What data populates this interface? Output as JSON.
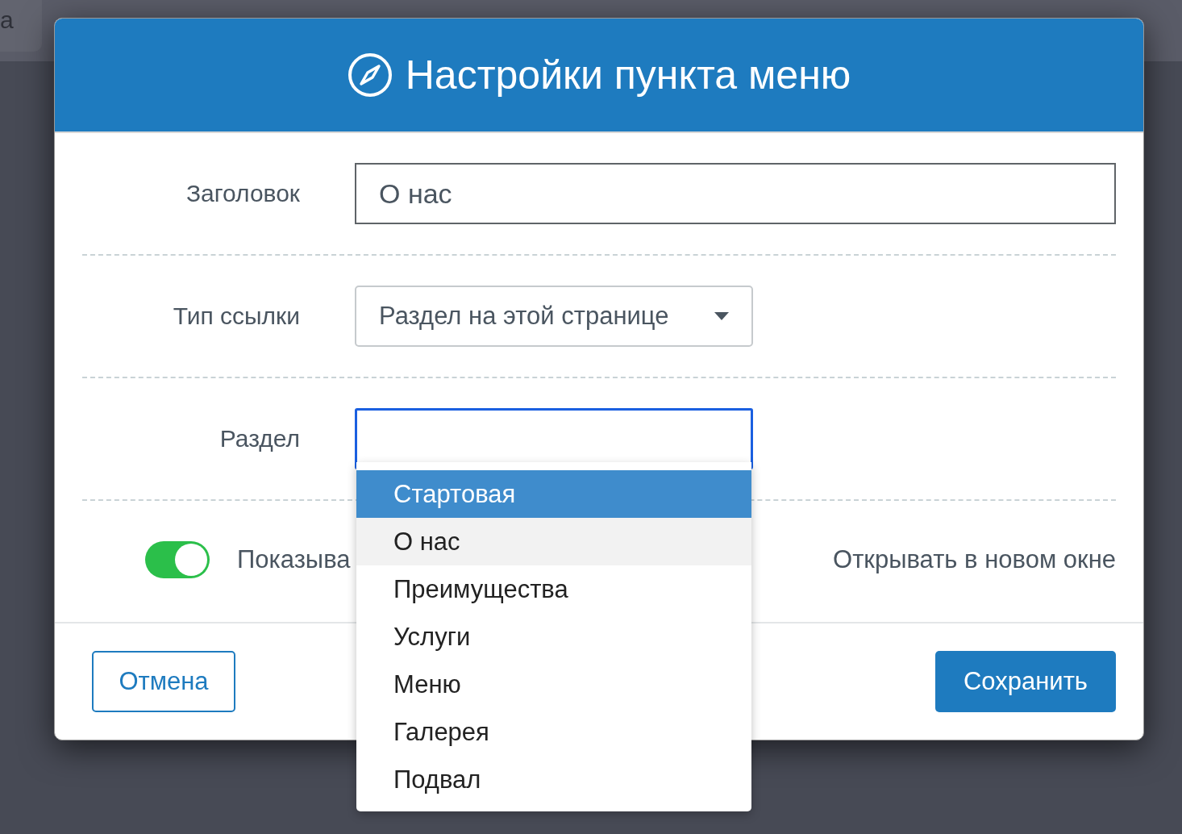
{
  "background": {
    "tab_label": "a"
  },
  "dialog": {
    "title": "Настройки пункта меню",
    "fields": [
      {
        "kind": "text",
        "label": "Заголовок",
        "value": "О нас"
      },
      {
        "kind": "select",
        "label": "Тип ссылки",
        "value": "Раздел на этой странице"
      },
      {
        "kind": "focused",
        "label": "Раздел"
      }
    ],
    "toggles": [
      {
        "label": "Показыва",
        "on": true
      },
      {
        "label": "Открывать в новом окне"
      }
    ],
    "dropdown": [
      {
        "label": "Стартовая",
        "selected": true,
        "hovered": false
      },
      {
        "label": "О нас",
        "selected": false,
        "hovered": true
      },
      {
        "label": "Преимущества",
        "selected": false,
        "hovered": false
      },
      {
        "label": "Услуги",
        "selected": false,
        "hovered": false
      },
      {
        "label": "Меню",
        "selected": false,
        "hovered": false
      },
      {
        "label": "Галерея",
        "selected": false,
        "hovered": false
      },
      {
        "label": "Подвал",
        "selected": false,
        "hovered": false
      }
    ],
    "buttons": [
      {
        "kind": "secondary",
        "label": "Отмена"
      },
      {
        "kind": "primary",
        "label": "Сохранить"
      }
    ]
  }
}
